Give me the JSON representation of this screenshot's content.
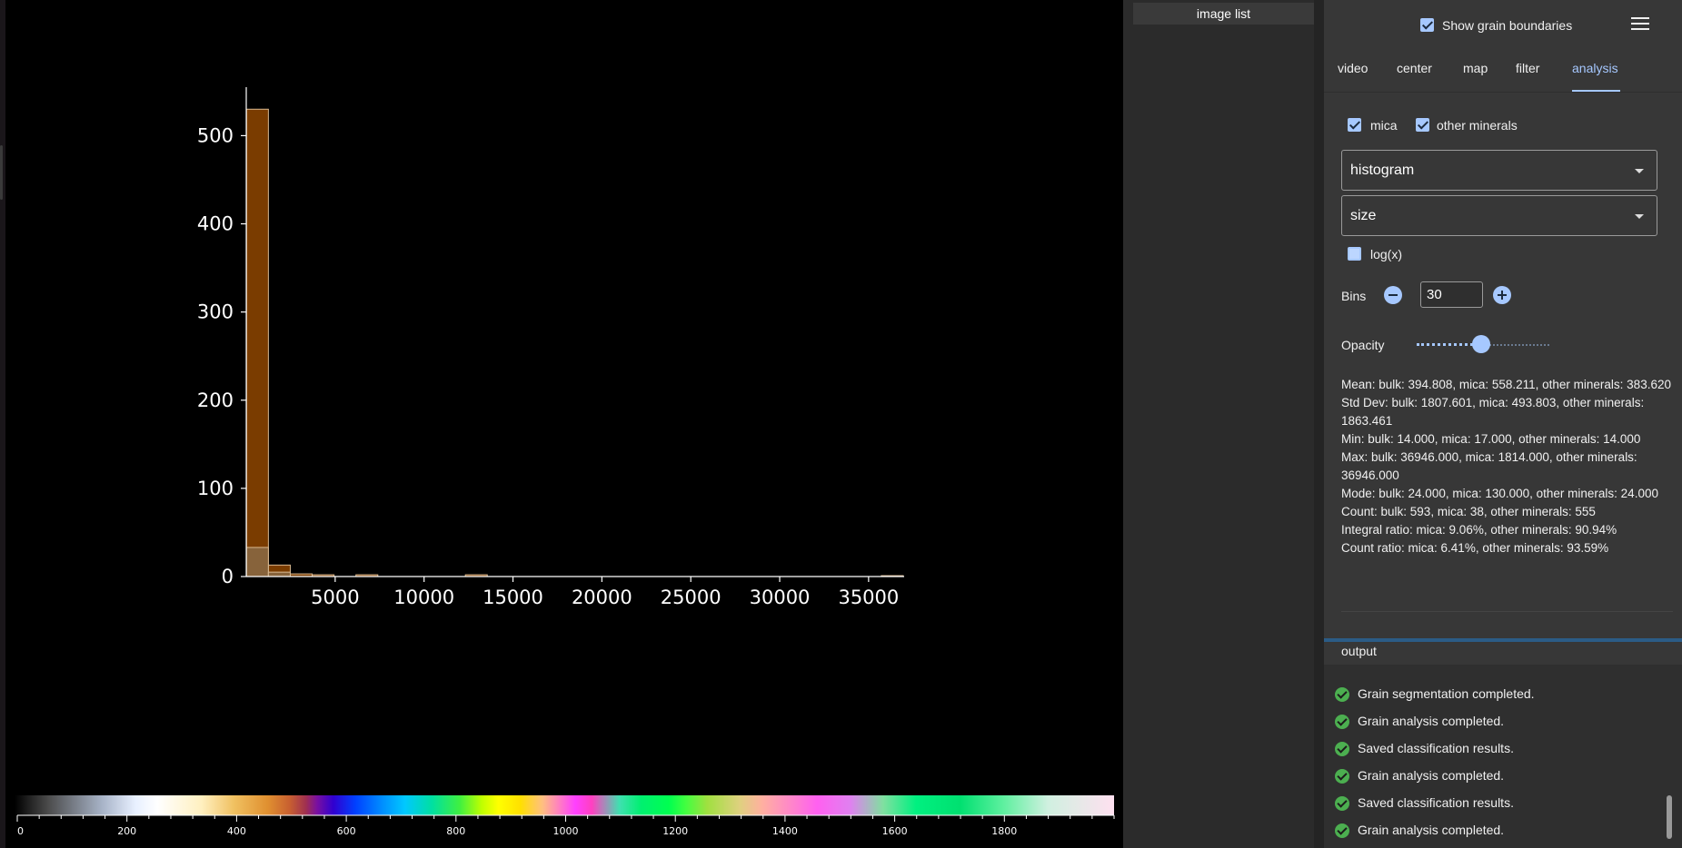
{
  "chart_data": {
    "type": "bar",
    "title": "",
    "xlabel": "",
    "ylabel": "",
    "xlim": [
      0,
      37000
    ],
    "ylim": [
      0,
      555
    ],
    "xticks": [
      5000,
      10000,
      15000,
      20000,
      25000,
      30000,
      35000
    ],
    "yticks": [
      0,
      100,
      200,
      300,
      400,
      500
    ],
    "bin_width": 1231,
    "series": [
      {
        "color": "#7a3c00",
        "bins": [
          {
            "x0": 14,
            "x1": 1245,
            "value": 530
          },
          {
            "x0": 1245,
            "x1": 2476,
            "value": 13
          },
          {
            "x0": 2476,
            "x1": 3707,
            "value": 3
          },
          {
            "x0": 3707,
            "x1": 4938,
            "value": 2
          },
          {
            "x0": 6169,
            "x1": 7400,
            "value": 2
          },
          {
            "x0": 12324,
            "x1": 13555,
            "value": 2
          },
          {
            "x0": 35715,
            "x1": 36946,
            "value": 1
          }
        ]
      },
      {
        "color": "#8a6a45",
        "bins": [
          {
            "x0": 14,
            "x1": 1245,
            "value": 33
          },
          {
            "x0": 1245,
            "x1": 2476,
            "value": 5
          }
        ]
      }
    ],
    "colorbar": {
      "ticks": [
        0,
        200,
        400,
        600,
        800,
        1000,
        1200,
        1400,
        1600,
        1800
      ],
      "range": [
        0,
        2000
      ]
    }
  },
  "image_list": {
    "title": "image list"
  },
  "header": {
    "show_boundaries_label": "Show grain boundaries"
  },
  "tabs": [
    {
      "label": "video"
    },
    {
      "label": "center"
    },
    {
      "label": "map"
    },
    {
      "label": "filter"
    },
    {
      "label": "analysis"
    }
  ],
  "analysis": {
    "mica_label": "mica",
    "other_minerals_label": "other minerals",
    "plot_type": "histogram",
    "variable": "size",
    "logx_label": "log(x)",
    "bins_label": "Bins",
    "bins_value": "30",
    "opacity_label": "Opacity",
    "opacity_value": 0.5,
    "stats": [
      "Mean: bulk: 394.808, mica: 558.211, other minerals: 383.620",
      "Std Dev: bulk: 1807.601, mica: 493.803, other minerals: 1863.461",
      "Min: bulk: 14.000, mica: 17.000, other minerals: 14.000",
      "Max: bulk: 36946.000, mica: 1814.000, other minerals: 36946.000",
      "Mode: bulk: 24.000, mica: 130.000, other minerals: 24.000",
      "Count: bulk: 593, mica: 38, other minerals: 555",
      "Integral ratio: mica: 9.06%, other minerals: 90.94%",
      "Count ratio: mica: 6.41%, other minerals: 93.59%"
    ]
  },
  "output": {
    "title": "output",
    "messages": [
      "Grain segmentation completed.",
      "Grain analysis completed.",
      "Saved classification results.",
      "Grain analysis completed.",
      "Saved classification results.",
      "Grain analysis completed."
    ]
  }
}
